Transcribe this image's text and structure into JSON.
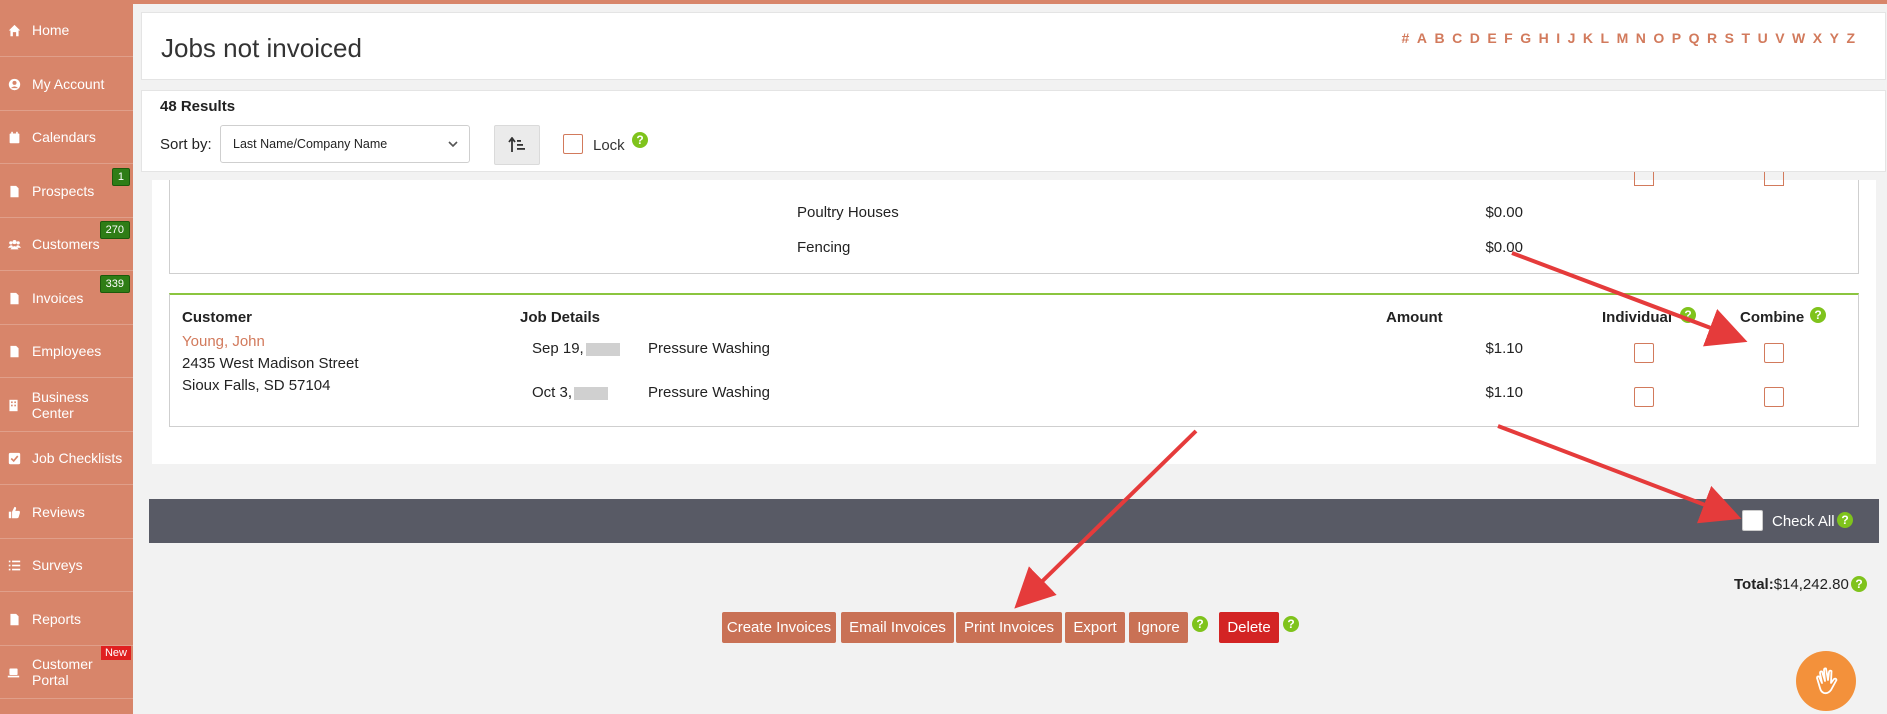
{
  "sidebar": {
    "items": [
      {
        "label": "Home",
        "icon": "home-icon"
      },
      {
        "label": "My Account",
        "icon": "user-circle-icon"
      },
      {
        "label": "Calendars",
        "icon": "calendar-icon"
      },
      {
        "label": "Prospects",
        "icon": "file-icon",
        "badge": "1"
      },
      {
        "label": "Customers",
        "icon": "users-icon",
        "badge": "270"
      },
      {
        "label": "Invoices",
        "icon": "file-icon",
        "badge": "339"
      },
      {
        "label": "Employees",
        "icon": "file-icon"
      },
      {
        "label": "Business Center",
        "icon": "building-icon"
      },
      {
        "label": "Job Checklists",
        "icon": "checkbox-icon"
      },
      {
        "label": "Reviews",
        "icon": "thumbs-up-icon"
      },
      {
        "label": "Surveys",
        "icon": "list-icon"
      },
      {
        "label": "Reports",
        "icon": "file-icon"
      },
      {
        "label": "Customer Portal",
        "icon": "laptop-icon",
        "tag": "New"
      }
    ]
  },
  "header": {
    "title": "Jobs not invoiced",
    "alphabet": [
      "#",
      "A",
      "B",
      "C",
      "D",
      "E",
      "F",
      "G",
      "H",
      "I",
      "J",
      "K",
      "L",
      "M",
      "N",
      "O",
      "P",
      "Q",
      "R",
      "S",
      "T",
      "U",
      "V",
      "W",
      "X",
      "Y",
      "Z"
    ]
  },
  "results": {
    "count": "48 Results",
    "sort_label": "Sort by:",
    "sort_value": "Last Name/Company Name",
    "lock_label": "Lock"
  },
  "previous_group": {
    "rows": [
      {
        "service": "Poultry Houses",
        "amount": "$0.00"
      },
      {
        "service": "Fencing",
        "amount": "$0.00"
      }
    ]
  },
  "table": {
    "headers": {
      "customer": "Customer",
      "job_details": "Job Details",
      "amount": "Amount",
      "individual": "Individual",
      "combine": "Combine"
    },
    "customer": {
      "name": "Young, John",
      "address1": "2435 West Madison Street",
      "address2": "Sioux Falls, SD 57104"
    },
    "rows": [
      {
        "date": "Sep 19,",
        "service": "Pressure Washing",
        "amount": "$1.10"
      },
      {
        "date": "Oct 3,",
        "service": "Pressure Washing",
        "amount": "$1.10"
      }
    ]
  },
  "checkall": {
    "label": "Check All"
  },
  "footer": {
    "total_label": "Total:",
    "total_value": "$14,242.80",
    "buttons": {
      "create": "Create Invoices",
      "email": "Email Invoices",
      "print": "Print Invoices",
      "export": "Export",
      "ignore": "Ignore",
      "delete": "Delete"
    }
  },
  "colors": {
    "sidebar": "#d8856a",
    "accent": "#d27a5c",
    "button": "#c97155",
    "delete": "#d32424",
    "help": "#7fc31c",
    "checkbar": "#585a65",
    "arrow": "#e53b3b"
  }
}
